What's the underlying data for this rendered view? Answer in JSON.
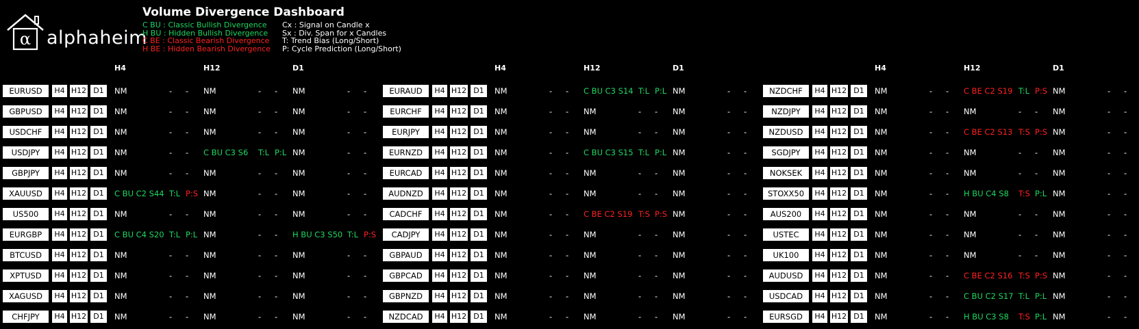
{
  "header": {
    "logo_text": "alphaheim",
    "title": "Volume Divergence Dashboard",
    "legend_left": [
      {
        "text": "C BU : Classic Bullish Divergence",
        "color": "#1ed760"
      },
      {
        "text": "H BU : Hidden Bullish Divergence",
        "color": "#1ed760"
      },
      {
        "text": "C BE : Classic Bearish Divergence",
        "color": "#ff2020"
      },
      {
        "text": "H BE : Hidden Bearish Divergence",
        "color": "#ff2020"
      }
    ],
    "legend_right": [
      "Cx : Signal on Candle x",
      "Sx : Div. Span for x Candles",
      "T: Trend Bias (Long/Short)",
      "P: Cycle Prediction (Long/Short)"
    ]
  },
  "colors": {
    "bullish": "#1ed760",
    "bearish": "#ff2020",
    "background": "#000000",
    "text": "#ffffff"
  },
  "timeframes": [
    "H4",
    "H12",
    "D1"
  ],
  "panels": [
    {
      "rows": [
        {
          "symbol": "EURUSD",
          "cells": [
            {
              "sig": "NM"
            },
            {
              "sig": "NM"
            },
            {
              "sig": "NM"
            }
          ]
        },
        {
          "symbol": "GBPUSD",
          "cells": [
            {
              "sig": "NM"
            },
            {
              "sig": "NM"
            },
            {
              "sig": "NM"
            }
          ]
        },
        {
          "symbol": "USDCHF",
          "cells": [
            {
              "sig": "NM"
            },
            {
              "sig": "NM"
            },
            {
              "sig": "NM"
            }
          ]
        },
        {
          "symbol": "USDJPY",
          "cells": [
            {
              "sig": "NM"
            },
            {
              "sig": "C BU C3 S6",
              "sc": "green",
              "t": "T:L",
              "tc": "green",
              "p": "P:L",
              "pc": "green"
            },
            {
              "sig": "NM"
            }
          ]
        },
        {
          "symbol": "GBPJPY",
          "cells": [
            {
              "sig": "NM"
            },
            {
              "sig": "NM"
            },
            {
              "sig": "NM"
            }
          ]
        },
        {
          "symbol": "XAUUSD",
          "cells": [
            {
              "sig": "C BU C2 S44",
              "sc": "green",
              "t": "T:L",
              "tc": "green",
              "p": "P:S",
              "pc": "red"
            },
            {
              "sig": "NM"
            },
            {
              "sig": "NM"
            }
          ]
        },
        {
          "symbol": "US500",
          "cells": [
            {
              "sig": "NM"
            },
            {
              "sig": "NM"
            },
            {
              "sig": "NM"
            }
          ]
        },
        {
          "symbol": "EURGBP",
          "cells": [
            {
              "sig": "C BU C4 S20",
              "sc": "green",
              "t": "T:L",
              "tc": "green",
              "p": "P:L",
              "pc": "green"
            },
            {
              "sig": "NM"
            },
            {
              "sig": "H BU C3 S50",
              "sc": "green",
              "t": "T:L",
              "tc": "green",
              "p": "P:S",
              "pc": "red"
            }
          ]
        },
        {
          "symbol": "BTCUSD",
          "cells": [
            {
              "sig": "NM"
            },
            {
              "sig": "NM"
            },
            {
              "sig": "NM"
            }
          ]
        },
        {
          "symbol": "XPTUSD",
          "cells": [
            {
              "sig": "NM"
            },
            {
              "sig": "NM"
            },
            {
              "sig": "NM"
            }
          ]
        },
        {
          "symbol": "XAGUSD",
          "cells": [
            {
              "sig": "NM"
            },
            {
              "sig": "NM"
            },
            {
              "sig": "NM"
            }
          ]
        },
        {
          "symbol": "CHFJPY",
          "cells": [
            {
              "sig": "NM"
            },
            {
              "sig": "NM"
            },
            {
              "sig": "NM"
            }
          ]
        }
      ]
    },
    {
      "rows": [
        {
          "symbol": "EURAUD",
          "cells": [
            {
              "sig": "NM"
            },
            {
              "sig": "C BU C3 S14",
              "sc": "green",
              "t": "T:L",
              "tc": "green",
              "p": "P:L",
              "pc": "green"
            },
            {
              "sig": "NM"
            }
          ]
        },
        {
          "symbol": "EURCHF",
          "cells": [
            {
              "sig": "NM"
            },
            {
              "sig": "NM"
            },
            {
              "sig": "NM"
            }
          ]
        },
        {
          "symbol": "EURJPY",
          "cells": [
            {
              "sig": "NM"
            },
            {
              "sig": "NM"
            },
            {
              "sig": "NM"
            }
          ]
        },
        {
          "symbol": "EURNZD",
          "cells": [
            {
              "sig": "NM"
            },
            {
              "sig": "C BU C3 S15",
              "sc": "green",
              "t": "T:L",
              "tc": "green",
              "p": "P:L",
              "pc": "green"
            },
            {
              "sig": "NM"
            }
          ]
        },
        {
          "symbol": "EURCAD",
          "cells": [
            {
              "sig": "NM"
            },
            {
              "sig": "NM"
            },
            {
              "sig": "NM"
            }
          ]
        },
        {
          "symbol": "AUDNZD",
          "cells": [
            {
              "sig": "NM"
            },
            {
              "sig": "NM"
            },
            {
              "sig": "NM"
            }
          ]
        },
        {
          "symbol": "CADCHF",
          "cells": [
            {
              "sig": "NM"
            },
            {
              "sig": "C BE C2 S19",
              "sc": "red",
              "t": "T:S",
              "tc": "red",
              "p": "P:S",
              "pc": "red"
            },
            {
              "sig": "NM"
            }
          ]
        },
        {
          "symbol": "CADJPY",
          "cells": [
            {
              "sig": "NM"
            },
            {
              "sig": "NM"
            },
            {
              "sig": "NM"
            }
          ]
        },
        {
          "symbol": "GBPAUD",
          "cells": [
            {
              "sig": "NM"
            },
            {
              "sig": "NM"
            },
            {
              "sig": "NM"
            }
          ]
        },
        {
          "symbol": "GBPCAD",
          "cells": [
            {
              "sig": "NM"
            },
            {
              "sig": "NM"
            },
            {
              "sig": "NM"
            }
          ]
        },
        {
          "symbol": "GBPNZD",
          "cells": [
            {
              "sig": "NM"
            },
            {
              "sig": "NM"
            },
            {
              "sig": "NM"
            }
          ]
        },
        {
          "symbol": "NZDCAD",
          "cells": [
            {
              "sig": "NM"
            },
            {
              "sig": "NM"
            },
            {
              "sig": "NM"
            }
          ]
        }
      ]
    },
    {
      "rows": [
        {
          "symbol": "NZDCHF",
          "cells": [
            {
              "sig": "NM"
            },
            {
              "sig": "C BE C2 S19",
              "sc": "red",
              "t": "T:L",
              "tc": "green",
              "p": "P:S",
              "pc": "red"
            },
            {
              "sig": "NM"
            }
          ]
        },
        {
          "symbol": "NZDJPY",
          "cells": [
            {
              "sig": "NM"
            },
            {
              "sig": "NM"
            },
            {
              "sig": "NM"
            }
          ]
        },
        {
          "symbol": "NZDUSD",
          "cells": [
            {
              "sig": "NM"
            },
            {
              "sig": "C BE C2 S13",
              "sc": "red",
              "t": "T:S",
              "tc": "red",
              "p": "P:S",
              "pc": "red"
            },
            {
              "sig": "NM"
            }
          ]
        },
        {
          "symbol": "SGDJPY",
          "cells": [
            {
              "sig": "NM"
            },
            {
              "sig": "NM"
            },
            {
              "sig": "NM"
            }
          ]
        },
        {
          "symbol": "NOKSEK",
          "cells": [
            {
              "sig": "NM"
            },
            {
              "sig": "NM"
            },
            {
              "sig": "NM"
            }
          ]
        },
        {
          "symbol": "STOXX50",
          "cells": [
            {
              "sig": "NM"
            },
            {
              "sig": "H BU C4 S8",
              "sc": "green",
              "t": "T:S",
              "tc": "red",
              "p": "P:L",
              "pc": "green"
            },
            {
              "sig": "NM"
            }
          ]
        },
        {
          "symbol": "AUS200",
          "cells": [
            {
              "sig": "NM"
            },
            {
              "sig": "NM"
            },
            {
              "sig": "NM"
            }
          ]
        },
        {
          "symbol": "USTEC",
          "cells": [
            {
              "sig": "NM"
            },
            {
              "sig": "NM"
            },
            {
              "sig": "NM"
            }
          ]
        },
        {
          "symbol": "UK100",
          "cells": [
            {
              "sig": "NM"
            },
            {
              "sig": "NM"
            },
            {
              "sig": "NM"
            }
          ]
        },
        {
          "symbol": "AUDUSD",
          "cells": [
            {
              "sig": "NM"
            },
            {
              "sig": "C BE C2 S16",
              "sc": "red",
              "t": "T:S",
              "tc": "red",
              "p": "P:S",
              "pc": "red"
            },
            {
              "sig": "NM"
            }
          ]
        },
        {
          "symbol": "USDCAD",
          "cells": [
            {
              "sig": "NM"
            },
            {
              "sig": "C BU C2 S17",
              "sc": "green",
              "t": "T:L",
              "tc": "green",
              "p": "P:L",
              "pc": "green"
            },
            {
              "sig": "NM"
            }
          ]
        },
        {
          "symbol": "EURSGD",
          "cells": [
            {
              "sig": "NM"
            },
            {
              "sig": "H BU C3 S8",
              "sc": "green",
              "t": "T:S",
              "tc": "red",
              "p": "P:L",
              "pc": "green"
            },
            {
              "sig": "NM"
            }
          ]
        }
      ]
    }
  ],
  "empty_marker": "-"
}
